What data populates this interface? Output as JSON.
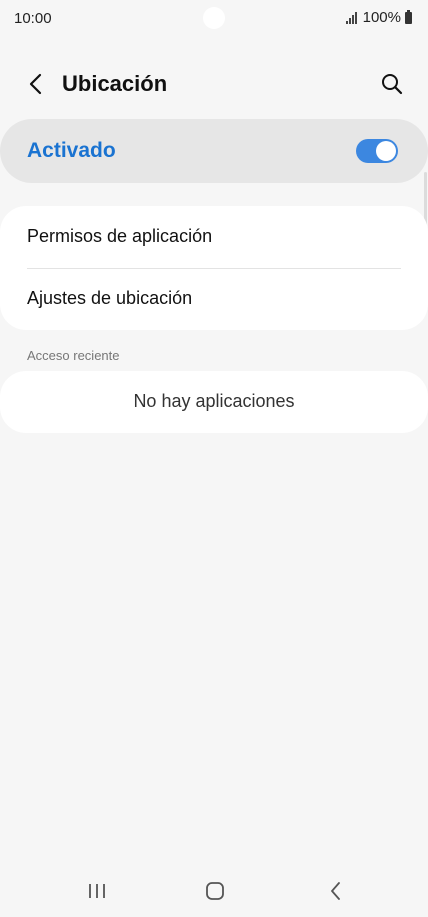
{
  "status_bar": {
    "time": "10:00",
    "battery": "100%"
  },
  "header": {
    "title": "Ubicación",
    "back_icon": "chevron-left-icon",
    "search_icon": "search-icon"
  },
  "master_toggle": {
    "label": "Activado",
    "state": "on",
    "accent_color": "#1a73d1"
  },
  "menu": {
    "items": [
      {
        "label": "Permisos de aplicación"
      },
      {
        "label": "Ajustes de ubicación"
      }
    ]
  },
  "recent_access": {
    "header": "Acceso reciente",
    "empty_message": "No hay aplicaciones"
  },
  "nav_bar": {
    "recents_icon": "recents-icon",
    "home_icon": "home-icon",
    "back_icon": "back-icon"
  }
}
